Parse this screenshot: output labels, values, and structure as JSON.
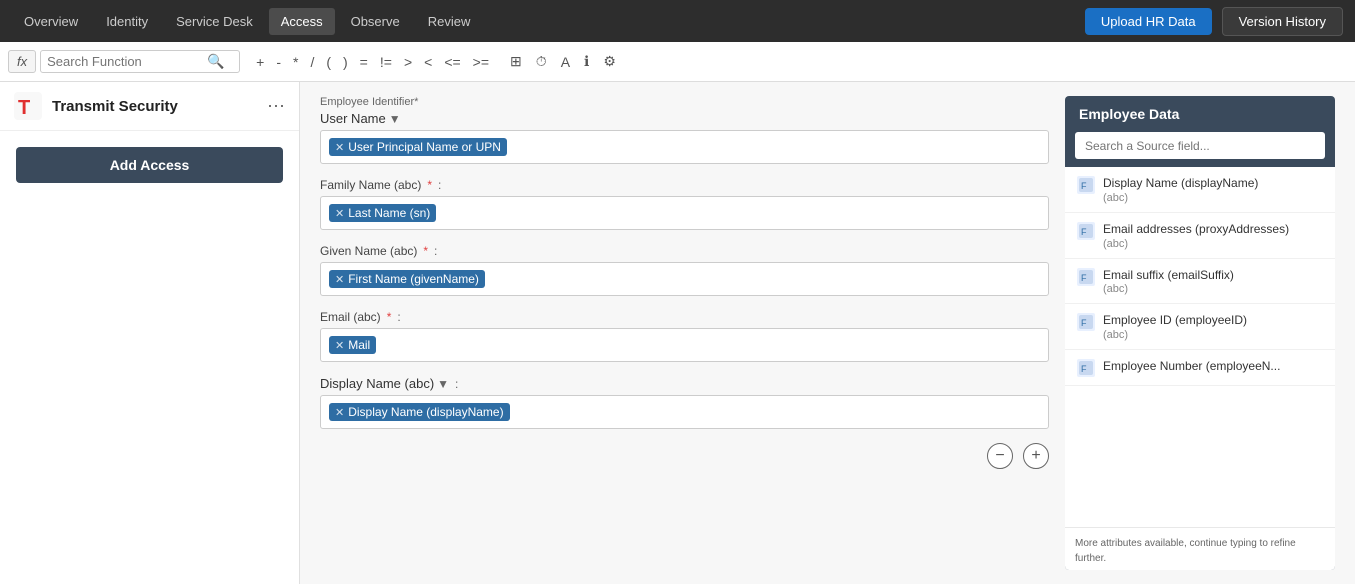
{
  "nav": {
    "items": [
      {
        "label": "Overview",
        "active": false
      },
      {
        "label": "Identity",
        "active": false
      },
      {
        "label": "Service Desk",
        "active": false
      },
      {
        "label": "Access",
        "active": true
      },
      {
        "label": "Observe",
        "active": false
      },
      {
        "label": "Review",
        "active": false
      }
    ],
    "upload_btn": "Upload HR Data",
    "version_btn": "Version History"
  },
  "toolbar": {
    "fx_label": "fx",
    "search_placeholder": "Search Function",
    "operators": [
      "+",
      "-",
      "*",
      "/",
      "(",
      ")",
      "=",
      "!=",
      ">",
      "<",
      "<=",
      ">="
    ],
    "icons": [
      "grid",
      "clock",
      "text",
      "info",
      "settings"
    ]
  },
  "sidebar": {
    "brand": "Transmit Security",
    "add_access_label": "Add Access"
  },
  "form": {
    "identifier_label": "Employee Identifier*",
    "user_name_label": "User Name",
    "upn_token": "User Principal Name or UPN",
    "family_name_label": "Family Name (abc)",
    "family_name_token": "Last Name (sn)",
    "given_name_label": "Given Name (abc)",
    "given_name_token": "First Name (givenName)",
    "email_label": "Email (abc)",
    "email_token": "Mail",
    "display_name_label": "Display Name (abc)",
    "display_name_token": "Display Name (displayName)"
  },
  "employee_panel": {
    "title": "Employee Data",
    "search_placeholder": "Search a Source field...",
    "items": [
      {
        "name": "Display Name (displayName)",
        "type": "(abc)"
      },
      {
        "name": "Email addresses (proxyAddresses)",
        "type": "(abc)"
      },
      {
        "name": "Email suffix (emailSuffix)",
        "type": "(abc)"
      },
      {
        "name": "Employee ID (employeeID)",
        "type": "(abc)"
      },
      {
        "name": "Employee Number (employeeN...",
        "type": ""
      }
    ],
    "footer_text": "More attributes available, continue typing to refine further."
  }
}
